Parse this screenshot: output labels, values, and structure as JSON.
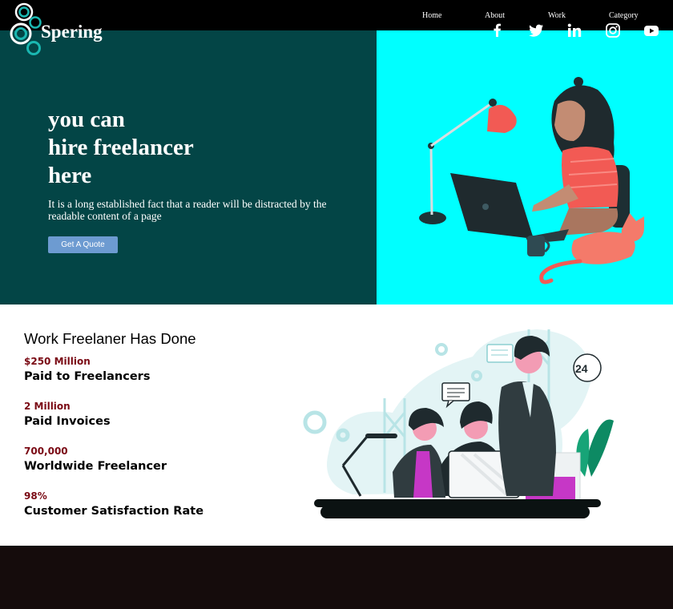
{
  "nav": {
    "links": [
      "Home",
      "About",
      "Work",
      "Category"
    ]
  },
  "hero": {
    "title_lines": [
      "you can",
      "hire freelancer",
      "here"
    ],
    "description": "It is a long established fact that a reader will be distracted by the readable content of a page",
    "button_label": "Get A Quote",
    "bg_left": "#034546",
    "bg_right": "#00ffff"
  },
  "stats": {
    "title": "Work Freelaner Has Done",
    "items": [
      {
        "value": "$250 Million",
        "label": "Paid to Freelancers"
      },
      {
        "value": "2 Million",
        "label": "Paid Invoices"
      },
      {
        "value": "700,000",
        "label": "Worldwide Freelancer"
      },
      {
        "value": "98%",
        "label": "Customer Satisfaction Rate"
      }
    ],
    "value_color": "#7a0a14",
    "badge_text": "24"
  },
  "footer": {
    "brand": "Spering",
    "social_icons": [
      "facebook-icon",
      "twitter-icon",
      "linkedin-icon",
      "instagram-icon",
      "youtube-icon"
    ],
    "bg": "#150c0c"
  }
}
